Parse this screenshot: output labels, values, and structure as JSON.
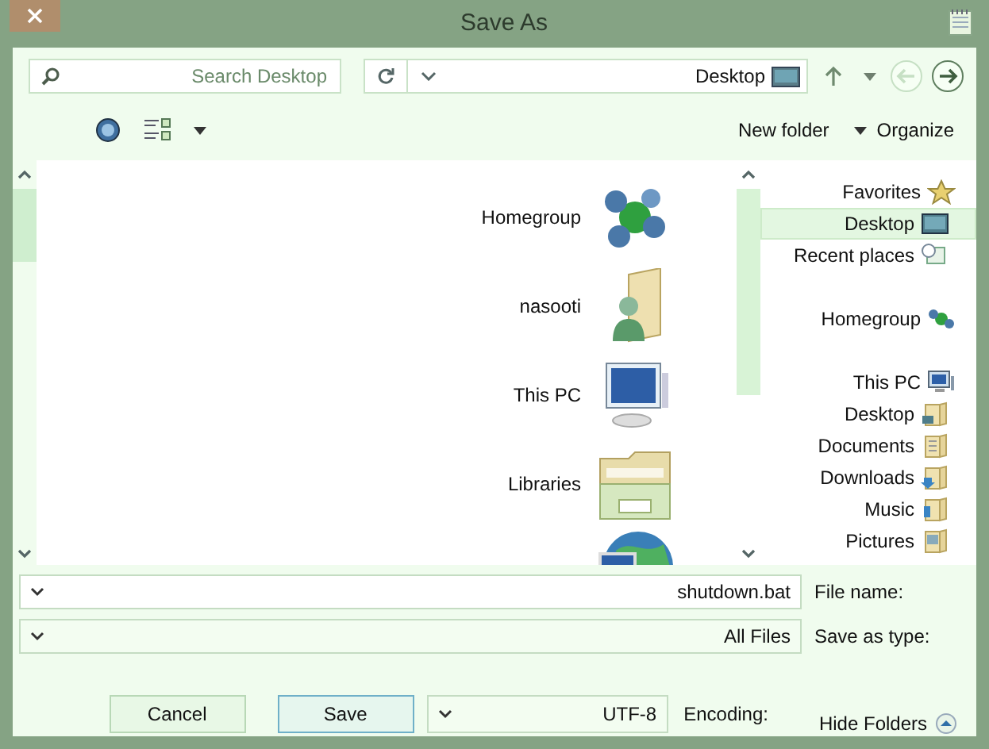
{
  "window": {
    "title": "Save As"
  },
  "address": {
    "location": "Desktop",
    "back_disabled": false,
    "forward_disabled": true
  },
  "search": {
    "placeholder": "Search Desktop"
  },
  "toolbar": {
    "organize": "Organize",
    "new_folder": "New folder"
  },
  "nav": [
    {
      "label": "Favorites",
      "kind": "favorites",
      "selected": false,
      "children": [
        {
          "label": "Desktop",
          "kind": "desktop",
          "selected": true
        },
        {
          "label": "Recent places",
          "kind": "recent",
          "selected": false
        }
      ]
    },
    {
      "label": "Homegroup",
      "kind": "homegroup",
      "selected": false
    },
    {
      "label": "This PC",
      "kind": "pc",
      "selected": false,
      "children": [
        {
          "label": "Desktop",
          "kind": "folder-desktop",
          "selected": false
        },
        {
          "label": "Documents",
          "kind": "folder-documents",
          "selected": false
        },
        {
          "label": "Downloads",
          "kind": "folder-downloads",
          "selected": false
        },
        {
          "label": "Music",
          "kind": "folder-music",
          "selected": false
        },
        {
          "label": "Pictures",
          "kind": "folder-pictures",
          "selected": false
        }
      ]
    }
  ],
  "files": [
    {
      "label": "Homegroup",
      "kind": "homegroup"
    },
    {
      "label": "nasooti",
      "kind": "user"
    },
    {
      "label": "This PC",
      "kind": "pc"
    },
    {
      "label": "Libraries",
      "kind": "libraries"
    },
    {
      "kind": "network"
    }
  ],
  "file_name": {
    "label": "File name:",
    "value": "shutdown.bat"
  },
  "save_as_type": {
    "label": "Save as type:",
    "value": "All Files"
  },
  "encoding": {
    "label": "Encoding:",
    "value": "UTF-8"
  },
  "buttons": [
    {
      "label": "Cancel",
      "default": false
    },
    {
      "label": "Save",
      "default": true
    }
  ],
  "hide_folders": "Hide Folders"
}
